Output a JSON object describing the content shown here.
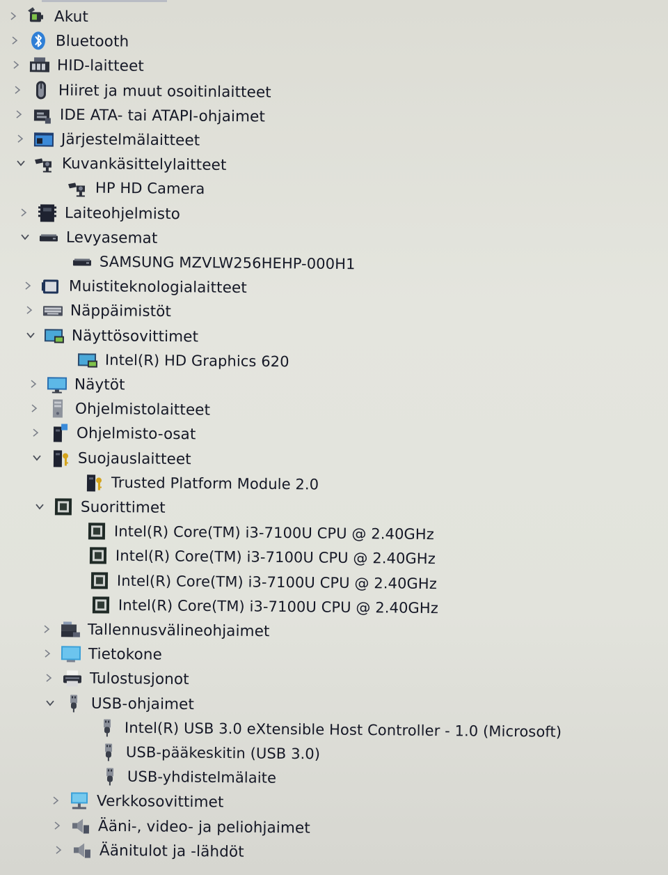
{
  "tree": [
    {
      "label": "Akut",
      "state": "collapsed",
      "icon": "battery-icon",
      "children": []
    },
    {
      "label": "Bluetooth",
      "state": "collapsed",
      "icon": "bluetooth-icon",
      "children": []
    },
    {
      "label": "HID-laitteet",
      "state": "collapsed",
      "icon": "hid-device-icon",
      "children": []
    },
    {
      "label": "Hiiret ja muut osoitinlaitteet",
      "state": "collapsed",
      "icon": "mouse-icon",
      "children": []
    },
    {
      "label": "IDE ATA- tai ATAPI-ohjaimet",
      "state": "collapsed",
      "icon": "ide-controller-icon",
      "children": []
    },
    {
      "label": "Järjestelmälaitteet",
      "state": "collapsed",
      "icon": "system-folder-icon",
      "children": []
    },
    {
      "label": "Kuvankäsittelylaitteet",
      "state": "expanded",
      "icon": "camera-icon",
      "children": [
        {
          "label": "HP HD Camera",
          "icon": "camera-icon"
        }
      ]
    },
    {
      "label": "Laiteohjelmisto",
      "state": "collapsed",
      "icon": "firmware-icon",
      "children": []
    },
    {
      "label": "Levyasemat",
      "state": "expanded",
      "icon": "disk-drive-icon",
      "children": [
        {
          "label": "SAMSUNG MZVLW256HEHP-000H1",
          "icon": "disk-drive-icon"
        }
      ]
    },
    {
      "label": "Muistiteknologialaitteet",
      "state": "collapsed",
      "icon": "memory-device-icon",
      "children": []
    },
    {
      "label": "Näppäimistöt",
      "state": "collapsed",
      "icon": "keyboard-icon",
      "children": []
    },
    {
      "label": "Näyttösovittimet",
      "state": "expanded",
      "icon": "display-adapter-icon",
      "children": [
        {
          "label": "Intel(R) HD Graphics 620",
          "icon": "display-adapter-icon"
        }
      ]
    },
    {
      "label": "Näytöt",
      "state": "collapsed",
      "icon": "monitor-icon",
      "children": []
    },
    {
      "label": "Ohjelmistolaitteet",
      "state": "collapsed",
      "icon": "software-device-icon",
      "children": []
    },
    {
      "label": "Ohjelmisto-osat",
      "state": "collapsed",
      "icon": "software-component-icon",
      "children": []
    },
    {
      "label": "Suojauslaitteet",
      "state": "expanded",
      "icon": "security-device-icon",
      "children": [
        {
          "label": "Trusted Platform Module 2.0",
          "icon": "security-device-icon"
        }
      ]
    },
    {
      "label": "Suorittimet",
      "state": "expanded",
      "icon": "processor-icon",
      "children": [
        {
          "label": "Intel(R) Core(TM) i3-7100U CPU @ 2.40GHz",
          "icon": "processor-icon"
        },
        {
          "label": "Intel(R) Core(TM) i3-7100U CPU @ 2.40GHz",
          "icon": "processor-icon"
        },
        {
          "label": "Intel(R) Core(TM) i3-7100U CPU @ 2.40GHz",
          "icon": "processor-icon"
        },
        {
          "label": "Intel(R) Core(TM) i3-7100U CPU @ 2.40GHz",
          "icon": "processor-icon"
        }
      ]
    },
    {
      "label": "Tallennusvälineohjaimet",
      "state": "collapsed",
      "icon": "storage-controller-icon",
      "children": []
    },
    {
      "label": "Tietokone",
      "state": "collapsed",
      "icon": "computer-icon",
      "children": []
    },
    {
      "label": "Tulostusjonot",
      "state": "collapsed",
      "icon": "printer-icon",
      "children": []
    },
    {
      "label": "USB-ohjaimet",
      "state": "expanded",
      "icon": "usb-icon",
      "children": [
        {
          "label": "Intel(R) USB 3.0 eXtensible Host Controller - 1.0 (Microsoft)",
          "icon": "usb-icon"
        },
        {
          "label": "USB-pääkeskitin (USB 3.0)",
          "icon": "usb-icon"
        },
        {
          "label": "USB-yhdistelmälaite",
          "icon": "usb-icon"
        }
      ]
    },
    {
      "label": "Verkkosovittimet",
      "state": "collapsed",
      "icon": "network-adapter-icon",
      "children": []
    },
    {
      "label": "Ääni-, video- ja peliohjaimet",
      "state": "collapsed",
      "icon": "sound-icon",
      "children": []
    },
    {
      "label": "Äänitulot ja -lähdöt",
      "state": "collapsed",
      "icon": "audio-io-icon",
      "children": []
    }
  ]
}
